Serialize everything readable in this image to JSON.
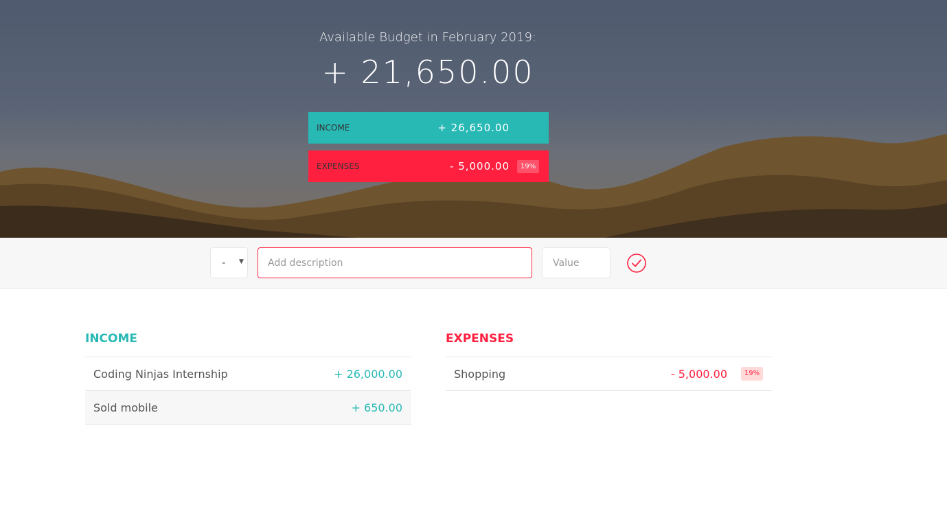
{
  "header": {
    "budget_title": "Available Budget in February 2019:",
    "budget_value": "+ 21,650.00",
    "income": {
      "label": "INCOME",
      "value": "+ 26,650.00"
    },
    "expenses": {
      "label": "EXPENSES",
      "value": "- 5,000.00",
      "percentage": "19%"
    }
  },
  "add_form": {
    "type_options": [
      "+",
      "-"
    ],
    "type_selected": "-",
    "description_placeholder": "Add description",
    "description_value": "",
    "value_placeholder": "Value",
    "value_value": "",
    "submit_icon": "checkmark-circle-icon"
  },
  "income_list": {
    "title": "INCOME",
    "items": [
      {
        "description": "Coding Ninjas Internship",
        "value": "+ 26,000.00"
      },
      {
        "description": "Sold mobile",
        "value": "+ 650.00"
      }
    ]
  },
  "expenses_list": {
    "title": "EXPENSES",
    "items": [
      {
        "description": "Shopping",
        "value": "- 5,000.00",
        "percentage": "19%"
      }
    ]
  },
  "colors": {
    "income": "#28b9b5",
    "expenses": "#ff2040",
    "expense_pct_bg": "#ffdad9"
  }
}
